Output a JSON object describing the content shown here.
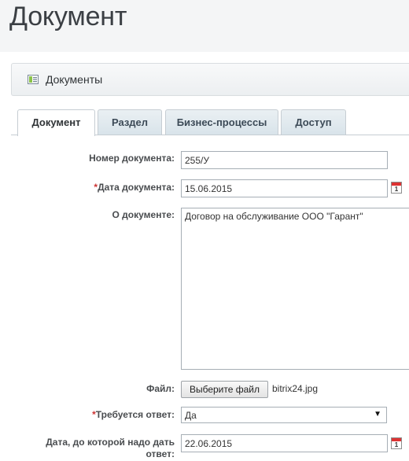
{
  "page": {
    "title": "Документ"
  },
  "toolbar": {
    "label": "Документы",
    "icon": "document-list-icon"
  },
  "tabs": [
    {
      "label": "Документ",
      "active": true
    },
    {
      "label": "Раздел",
      "active": false
    },
    {
      "label": "Бизнес-процессы",
      "active": false
    },
    {
      "label": "Доступ",
      "active": false
    }
  ],
  "form": {
    "doc_number": {
      "label": "Номер документа:",
      "value": "255/У"
    },
    "doc_date": {
      "label": "Дата документа:",
      "value": "15.06.2015",
      "required": "*"
    },
    "about": {
      "label": "О документе:",
      "value": "Договор на обслуживание ООО \"Гарант\""
    },
    "file": {
      "label": "Файл:",
      "button": "Выберите файл",
      "filename": "bitrix24.jpg"
    },
    "answer_required": {
      "label": "Требуется ответ:",
      "value": "Да",
      "required": "*"
    },
    "answer_date": {
      "label_line1": "Дата, до которой надо дать",
      "label_line2": "ответ:",
      "value": "22.06.2015"
    }
  },
  "calendar": {
    "day": "1"
  },
  "colors": {
    "required": "#cc3333",
    "tab_bg": "#d8e3ea",
    "border": "#a6aeb5"
  }
}
